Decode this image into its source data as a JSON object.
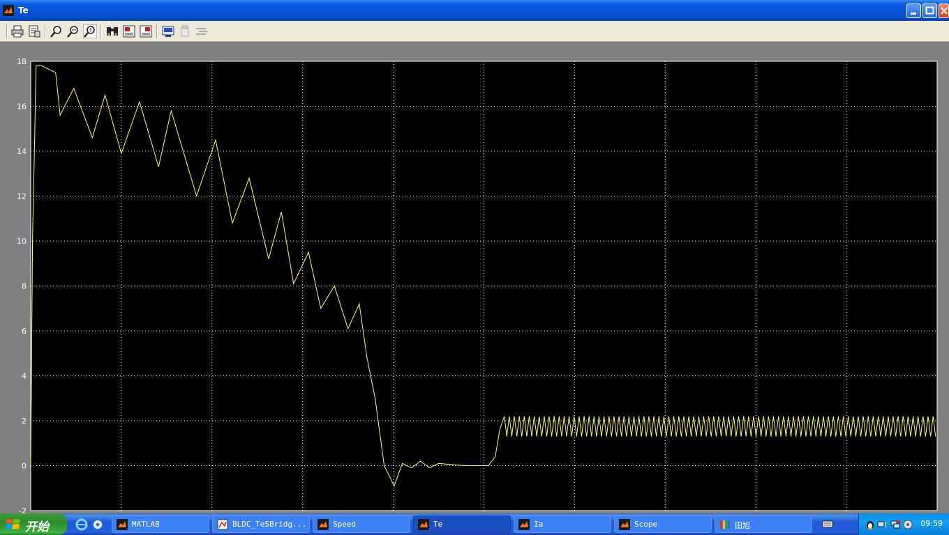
{
  "window": {
    "title": "Te",
    "icon": "matlab-icon"
  },
  "toolbar": [
    {
      "name": "print-icon"
    },
    {
      "name": "print-setup-icon"
    },
    {
      "name": "zoom-icon"
    },
    {
      "name": "zoom-x-icon"
    },
    {
      "name": "zoom-y-icon"
    },
    {
      "name": "autoscale-binoculars-icon"
    },
    {
      "name": "save-axes-icon"
    },
    {
      "name": "restore-axes-icon"
    },
    {
      "name": "parameters-icon"
    },
    {
      "name": "floating-scope-icon"
    },
    {
      "name": "signal-selection-icon"
    }
  ],
  "chart_data": {
    "type": "line",
    "title": "",
    "xlabel": "",
    "ylabel": "",
    "xlim": [
      0,
      0.2
    ],
    "ylim": [
      -2,
      18
    ],
    "yticks": [
      -2,
      0,
      2,
      4,
      6,
      8,
      10,
      12,
      14,
      16,
      18
    ],
    "ytick_labels": [
      "-2",
      "0",
      "2",
      "4",
      "6",
      "8",
      "10",
      "12",
      "14",
      "16",
      "18"
    ],
    "grid": true,
    "colors": {
      "background": "#000000",
      "axes_bg": "#000000",
      "line": "#ffff66",
      "grid": "#ffffff",
      "tick_text": "#ffffff",
      "frame": "#808080"
    },
    "series": [
      {
        "points": [
          [
            0,
            0
          ],
          [
            0.0004,
            10
          ],
          [
            0.0012,
            17.8
          ],
          [
            0.0024,
            17.8
          ],
          [
            0.0055,
            17.5
          ],
          [
            0.0065,
            15.6
          ],
          [
            0.0095,
            16.8
          ],
          [
            0.0136,
            14.6
          ],
          [
            0.0164,
            16.5
          ],
          [
            0.02,
            13.9
          ],
          [
            0.024,
            16.2
          ],
          [
            0.0282,
            13.3
          ],
          [
            0.031,
            15.8
          ],
          [
            0.0366,
            12.0
          ],
          [
            0.0408,
            14.5
          ],
          [
            0.0445,
            10.8
          ],
          [
            0.0482,
            12.8
          ],
          [
            0.0525,
            9.2
          ],
          [
            0.0553,
            11.3
          ],
          [
            0.058,
            8.1
          ],
          [
            0.0613,
            9.5
          ],
          [
            0.064,
            7.0
          ],
          [
            0.067,
            8.0
          ],
          [
            0.07,
            6.1
          ],
          [
            0.0725,
            7.2
          ],
          [
            0.0742,
            4.8
          ],
          [
            0.076,
            3.0
          ],
          [
            0.078,
            0.0
          ],
          [
            0.0802,
            -0.9
          ],
          [
            0.082,
            0.1
          ],
          [
            0.084,
            -0.1
          ],
          [
            0.086,
            0.2
          ],
          [
            0.088,
            -0.1
          ],
          [
            0.09,
            0.1
          ],
          [
            0.096,
            0.0
          ],
          [
            0.101,
            0.0
          ],
          [
            0.1025,
            0.4
          ],
          [
            0.1035,
            1.6
          ],
          [
            0.1045,
            2.2
          ],
          [
            0.106,
            1.5
          ],
          [
            0.108,
            2.2
          ],
          [
            0.2,
            2.2
          ]
        ],
        "ripple": {
          "from": 0.1045,
          "to": 0.2,
          "min": 1.3,
          "max": 2.2,
          "period": 0.0011
        }
      }
    ]
  },
  "taskbar": {
    "start_label": "开始",
    "quick_launch": [
      {
        "name": "ie-icon"
      },
      {
        "name": "desktop-icon"
      }
    ],
    "tasks": [
      {
        "label": "MATLAB",
        "icon": "matlab-icon",
        "active": false
      },
      {
        "label": "BLDC_TeSBridg...",
        "icon": "simulink-model-icon",
        "active": false
      },
      {
        "label": "Speed",
        "icon": "matlab-icon",
        "active": false
      },
      {
        "label": "Te",
        "icon": "matlab-icon",
        "active": true
      },
      {
        "label": "Ia",
        "icon": "matlab-icon",
        "active": false
      },
      {
        "label": "Scope",
        "icon": "matlab-icon",
        "active": false
      },
      {
        "label": "田旭",
        "icon": "chat-icon",
        "active": false
      }
    ],
    "clock": "09:59"
  }
}
